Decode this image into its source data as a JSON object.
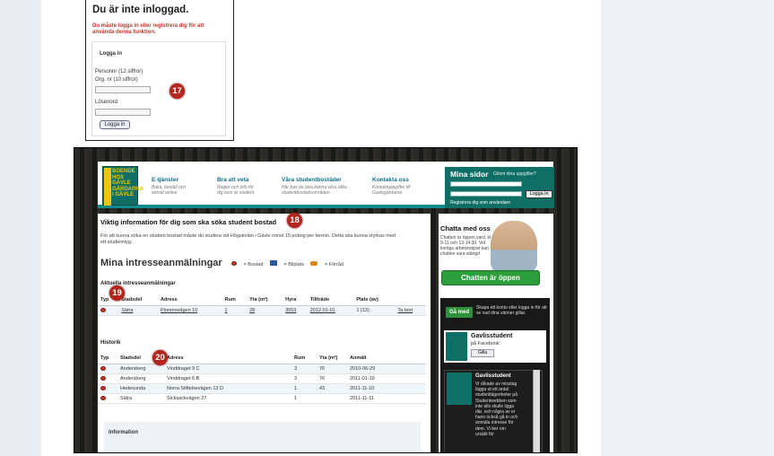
{
  "login": {
    "title": "Du är inte inloggad.",
    "error": "Du måste logga in eller registrera dig för att använda denna funktion.",
    "form_title": "Logga in",
    "personnr": "Personnr (12 siffror)",
    "orgnr": "Org. nr (10 siffror)",
    "password": "Lösenord",
    "button": "Logga in"
  },
  "badges": {
    "b17": "17",
    "b18": "18",
    "b19": "19",
    "b20": "20"
  },
  "logo": {
    "line1": "BOENDE",
    "line2": "HOS GÄVLE",
    "line3": "GÅRDARNA",
    "line4": "I GÄVLE",
    "side": "STUDENT"
  },
  "nav": [
    {
      "title": "E-tjänster",
      "sub1": "Boka, beställ och",
      "sub2": "anmäl online"
    },
    {
      "title": "Bra att veta",
      "sub1": "Regler och info för",
      "sub2": "dig som är student"
    },
    {
      "title": "Våra studentbostäder",
      "sub1": "Här kan du läsa känna våra olika",
      "sub2": "studentbostadsområden"
    },
    {
      "title": "Kontakta oss",
      "sub1": "Kontaktuppgifter till",
      "sub2": "Gavlegårdarna"
    }
  ],
  "mina": {
    "title": "Mina sidor",
    "forgot": "Glömt dina uppgifter?",
    "personnr_ph": "Personnr (12 siffror) Org.nr (10 siffror)",
    "pass_ph": "Lösenord",
    "login": "Logga in",
    "register": "Registrera dig som användare"
  },
  "main": {
    "heading": "Viktig information för dig som ska söka student bostad",
    "text": "För att kunna söka en student bostad måste du studera vid Högskolan i Gävle minst 15 poäng per termin. Detta ska kunna styrkas med ett studieintyg.",
    "title": "Mina intresseanmälningar",
    "legend": [
      "= Bostad",
      "= Bilplats",
      "= Förråd"
    ],
    "current_label": "Aktuella intresseanmälningar",
    "history_label": "Historik",
    "info_label": "Information"
  },
  "current": {
    "headers": [
      "Typ",
      "Stadsdel",
      "Adress",
      "Rum",
      "Yta (m²)",
      "Hyra",
      "Tillträde",
      "Plats (av)",
      ""
    ],
    "row": [
      "",
      "Sätra",
      "Pinnmovägen 10",
      "1",
      "28",
      "3553",
      "2012-01-01",
      "1 (13)",
      "Ta bort"
    ]
  },
  "history": {
    "headers": [
      "Typ",
      "Stadsdel",
      "Adress",
      "Rum",
      "Yta (m²)",
      "Anmält"
    ],
    "rows": [
      [
        "",
        "Andersberg",
        "Vinddraget 9 C",
        "3",
        "76",
        "2010-06-29"
      ],
      [
        "",
        "Andersberg",
        "Vinddraget 6 B",
        "3",
        "76",
        "2011-01-19"
      ],
      [
        "",
        "Hedesunda",
        "Norra Stiftelsevägen 13 D",
        "1",
        "43",
        "2011-11-10"
      ],
      [
        "",
        "Sätra",
        "Sicksackvägen 27",
        "1",
        "",
        "2011-11-11"
      ]
    ]
  },
  "side": {
    "chat_title": "Chatta med oss",
    "chat_text": "Chatten är öppen vard. kl 9-11 och 13-14:30. Vid kortiga arbetstoppar kan chatten vara stängd",
    "chat_button": "Chatten är öppen",
    "ga_med": "Gå med",
    "ga_text": "Skapa ett konto eller logga in för att se vad dina vänner gillar.",
    "fb_name": "Gavlisstudent",
    "fb_on": "på Facebook",
    "fb_like": "Gilla",
    "post_name": "Gavlisstudent",
    "post_text": "Vi råkade av misstag lägga ut ett antal studentlägenheter på Studentwebben som inte alls skulle ligga där, och några av er hann också gå in och anmäla intresse för dem. Vi ber om ursäkt för"
  }
}
